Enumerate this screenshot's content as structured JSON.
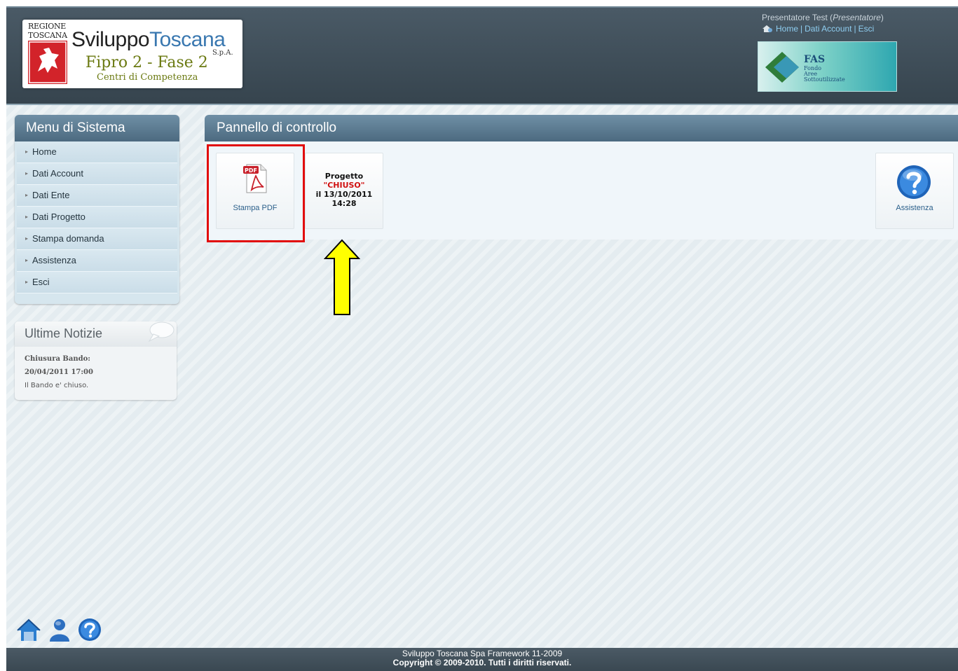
{
  "header": {
    "logo": {
      "regione": "REGIONE TOSCANA",
      "name_part1": "Sviluppo",
      "name_part2": "Toscana",
      "spa": "S.p.A.",
      "subtitle": "Fipro 2 - Fase 2",
      "subtitle2": "Centri di Competenza"
    },
    "user": {
      "name": "Presentatore Test",
      "role": "Presentatore"
    },
    "links": [
      "Home",
      "Dati Account",
      "Esci"
    ],
    "fas_banner": {
      "title": "FAS",
      "description": [
        "Fondo",
        "Aree",
        "Sottoutilizzate"
      ]
    }
  },
  "sidebar": {
    "title": "Menu di Sistema",
    "items": [
      {
        "label": "Home"
      },
      {
        "label": "Dati Account"
      },
      {
        "label": "Dati Ente"
      },
      {
        "label": "Dati Progetto"
      },
      {
        "label": "Stampa domanda"
      },
      {
        "label": "Assistenza"
      },
      {
        "label": "Esci"
      }
    ]
  },
  "news": {
    "title": "Ultime Notizie",
    "item_title": "Chiusura Bando:",
    "item_date": "20/04/2011 17:00",
    "item_text": "Il Bando e' chiuso."
  },
  "main": {
    "title": "Pannello di controllo",
    "tiles": {
      "pdf": {
        "label": "Stampa PDF",
        "icon": "pdf-icon"
      },
      "status": {
        "line1": "Progetto",
        "line2": "\"CHIUSO\"",
        "line3": "il 13/10/2011",
        "line4": "14:28"
      },
      "help": {
        "label": "Assistenza",
        "icon": "help-icon"
      }
    }
  },
  "footer": {
    "line1": "Sviluppo Toscana Spa Framework 11-2009",
    "line2": "Copyright © 2009-2010. Tutti i diritti riservati."
  },
  "colors": {
    "header_bg": "#3e4d58",
    "panel_header": "#5c7a90",
    "highlight": "#e20b0b",
    "arrow": "#ffff00",
    "closed_text": "#d01010"
  }
}
